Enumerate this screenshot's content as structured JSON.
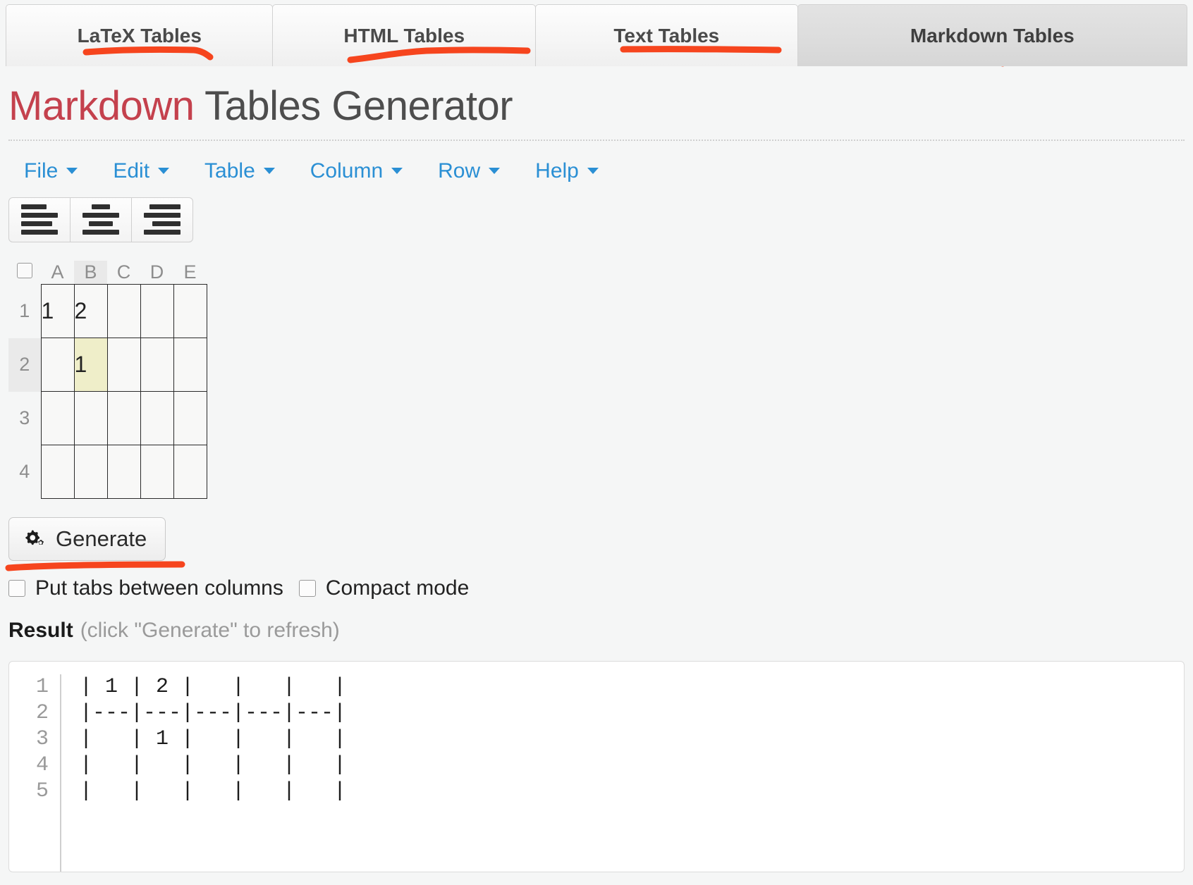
{
  "tabs": [
    {
      "label": "LaTeX Tables",
      "active": false
    },
    {
      "label": "HTML Tables",
      "active": false
    },
    {
      "label": "Text Tables",
      "active": false
    },
    {
      "label": "Markdown Tables",
      "active": true
    }
  ],
  "header": {
    "title_accent": "Markdown",
    "title_rest": " Tables Generator"
  },
  "menubar": [
    {
      "label": "File"
    },
    {
      "label": "Edit"
    },
    {
      "label": "Table"
    },
    {
      "label": "Column"
    },
    {
      "label": "Row"
    },
    {
      "label": "Help"
    }
  ],
  "align_buttons": [
    {
      "name": "align-left",
      "title": "Align left"
    },
    {
      "name": "align-center",
      "title": "Align center"
    },
    {
      "name": "align-right",
      "title": "Align right"
    }
  ],
  "grid": {
    "select_all": "",
    "columns": [
      "A",
      "B",
      "C",
      "D",
      "E"
    ],
    "selected_column": "B",
    "rows": [
      "1",
      "2",
      "3",
      "4"
    ],
    "selected_row": "2",
    "active_cell": "B2",
    "cells": [
      [
        "1",
        "2",
        "",
        "",
        ""
      ],
      [
        "",
        "1",
        "",
        "",
        ""
      ],
      [
        "",
        "",
        "",
        "",
        ""
      ],
      [
        "",
        "",
        "",
        "",
        ""
      ]
    ]
  },
  "generate": {
    "label": "Generate",
    "icon": "gears-icon"
  },
  "options": [
    {
      "label": "Put tabs between columns",
      "checked": false
    },
    {
      "label": "Compact mode",
      "checked": false
    }
  ],
  "result": {
    "label": "Result",
    "hint": "(click \"Generate\" to refresh)",
    "line_numbers": [
      "1",
      "2",
      "3",
      "4",
      "5"
    ],
    "lines": [
      "| 1 | 2 |   |   |   |",
      "|---|---|---|---|---|",
      "|   | 1 |   |   |   |",
      "|   |   |   |   |   |",
      "|   |   |   |   |   |"
    ]
  },
  "annotations": {
    "color": "#f6451e",
    "strokes": [
      "tab-1-underline",
      "tab-2-underline",
      "tab-3-underline",
      "tab-4-underline",
      "generate-underline"
    ]
  }
}
